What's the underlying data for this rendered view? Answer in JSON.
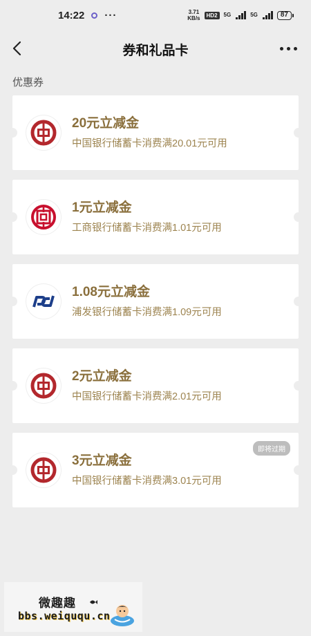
{
  "status_bar": {
    "time": "14:22",
    "more": "···",
    "net_speed_value": "3.71",
    "net_speed_unit": "KB/s",
    "hd": "HD2",
    "signal1": "5G",
    "signal2": "5G",
    "battery": "87"
  },
  "nav": {
    "title": "券和礼品卡"
  },
  "section": {
    "label": "优惠券"
  },
  "coupons": [
    {
      "title": "20元立减金",
      "desc": "中国银行储蓄卡消费满20.01元可用",
      "bank": "boc-icon"
    },
    {
      "title": "1元立减金",
      "desc": "工商银行储蓄卡消费满1.01元可用",
      "bank": "icbc-icon"
    },
    {
      "title": "1.08元立减金",
      "desc": "浦发银行储蓄卡消费满1.09元可用",
      "bank": "spdb-icon"
    },
    {
      "title": "2元立减金",
      "desc": "中国银行储蓄卡消费满2.01元可用",
      "bank": "boc-icon"
    },
    {
      "title": "3元立减金",
      "desc": "中国银行储蓄卡消费满3.01元可用",
      "bank": "boc-icon",
      "badge": "即将过期"
    }
  ],
  "watermark": {
    "title": "微趣趣",
    "url": "bbs.weiququ.cn"
  },
  "colors": {
    "coupon_title": "#8a6f3c",
    "coupon_desc": "#9d8450",
    "boc_red": "#b3282d",
    "icbc_red": "#c8102e",
    "spdb_blue": "#1d3f8a"
  }
}
